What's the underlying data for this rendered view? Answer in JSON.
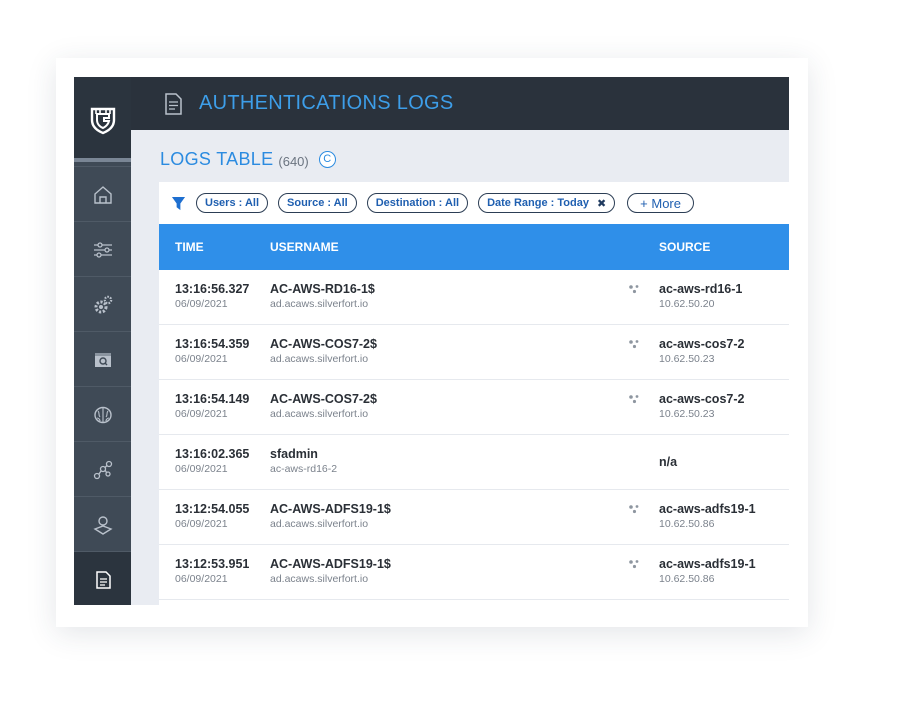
{
  "header": {
    "title": "AUTHENTICATIONS LOGS"
  },
  "logs": {
    "title": "LOGS TABLE",
    "count": "(640)",
    "refresh_glyph": "C"
  },
  "filters": {
    "users": "Users : All",
    "source": "Source : All",
    "destination": "Destination : All",
    "date_range": "Date Range : Today",
    "date_range_clear": "✖",
    "more": "+ More"
  },
  "table": {
    "columns": {
      "time": "TIME",
      "username": "USERNAME",
      "source": "SOURCE"
    },
    "rows": [
      {
        "time": "13:16:56.327",
        "date": "06/09/2021",
        "user": "AC-AWS-RD16-1$",
        "domain": "ad.acaws.silverfort.io",
        "source": "ac-aws-rd16-1",
        "ip": "10.62.50.20"
      },
      {
        "time": "13:16:54.359",
        "date": "06/09/2021",
        "user": "AC-AWS-COS7-2$",
        "domain": "ad.acaws.silverfort.io",
        "source": "ac-aws-cos7-2",
        "ip": "10.62.50.23"
      },
      {
        "time": "13:16:54.149",
        "date": "06/09/2021",
        "user": "AC-AWS-COS7-2$",
        "domain": "ad.acaws.silverfort.io",
        "source": "ac-aws-cos7-2",
        "ip": "10.62.50.23"
      },
      {
        "time": "13:16:02.365",
        "date": "06/09/2021",
        "user": "sfadmin",
        "domain": "ac-aws-rd16-2",
        "source": "n/a",
        "ip": ""
      },
      {
        "time": "13:12:54.055",
        "date": "06/09/2021",
        "user": "AC-AWS-ADFS19-1$",
        "domain": "ad.acaws.silverfort.io",
        "source": "ac-aws-adfs19-1",
        "ip": "10.62.50.86"
      },
      {
        "time": "13:12:53.951",
        "date": "06/09/2021",
        "user": "AC-AWS-ADFS19-1$",
        "domain": "ad.acaws.silverfort.io",
        "source": "ac-aws-adfs19-1",
        "ip": "10.62.50.86"
      }
    ]
  },
  "sidebar": {
    "items": [
      {
        "icon": "home-icon"
      },
      {
        "icon": "sliders-icon"
      },
      {
        "icon": "gears-icon"
      },
      {
        "icon": "browser-search-icon"
      },
      {
        "icon": "brain-icon"
      },
      {
        "icon": "network-icon"
      },
      {
        "icon": "user-icon"
      },
      {
        "icon": "document-icon"
      }
    ]
  },
  "colors": {
    "accent": "#2f8fe9",
    "header_bg": "#2a323c",
    "sidebar_bg": "#3f4a56"
  }
}
